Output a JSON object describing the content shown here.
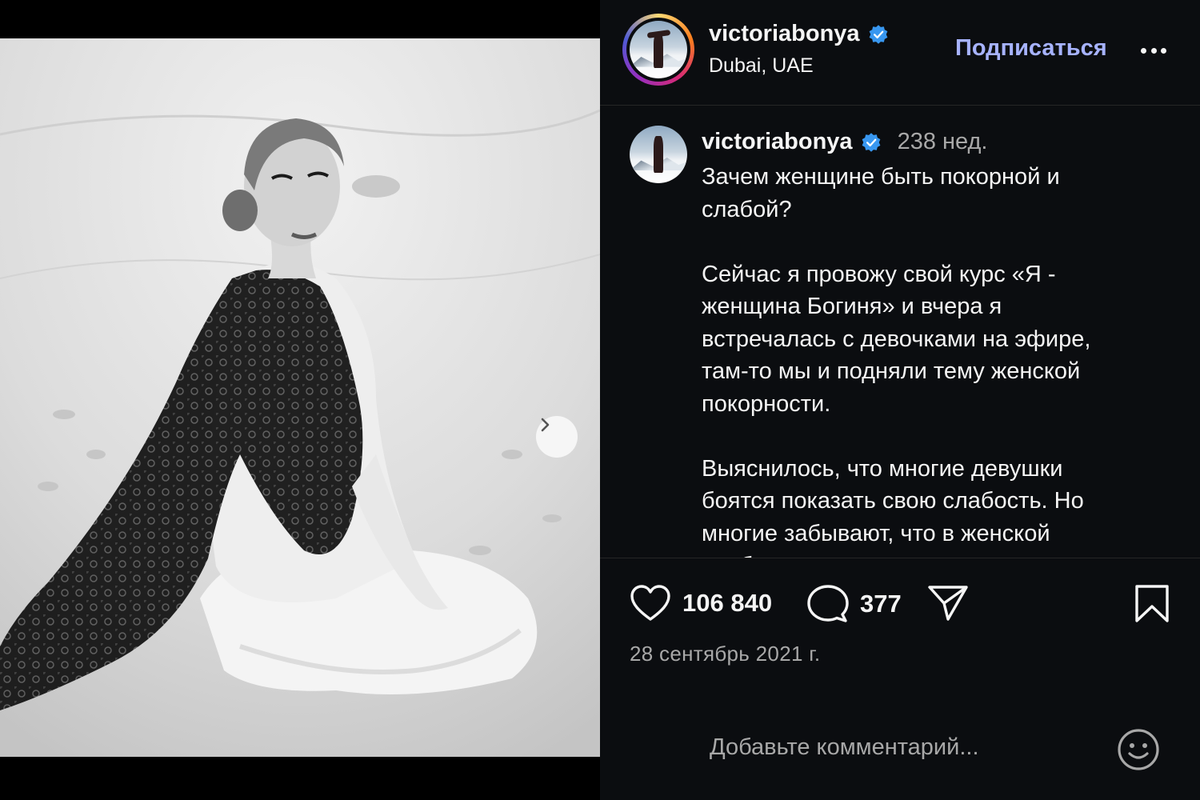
{
  "post": {
    "username": "victoriabonya",
    "location": "Dubai, UAE",
    "follow_label": "Подписаться",
    "more_label": "More options",
    "caption": {
      "username": "victoriabonya",
      "time": "238 нед.",
      "text": "Зачем женщине быть покорной и\nслабой?\n\nСейчас я провожу свой курс «Я -\nженщина Богиня» и вчера я\nвстречалась с девочками на эфире,\nтам-то мы и подняли тему женской\nпокорности.\n\nВыяснилось, что многие девушки\nбоятся показать свою слабость. Но\nмногие забывают, что в женской\nслабости"
    },
    "likes": "106 840",
    "comments": "377",
    "date": "28 сентябрь 2021 г.",
    "comment_placeholder": "Добавьте комментарий...",
    "carousel": {
      "current": 1,
      "total": 2
    }
  },
  "colors": {
    "panel_bg": "#0b0d10",
    "accent_follow": "#a7b3ff",
    "verified": "#3897f0",
    "muted": "#a8a8a8"
  },
  "icons": [
    "verified-badge-icon",
    "more-dots-icon",
    "heart-icon",
    "comment-icon",
    "share-icon",
    "bookmark-icon",
    "emoji-icon",
    "chevron-right-icon"
  ]
}
